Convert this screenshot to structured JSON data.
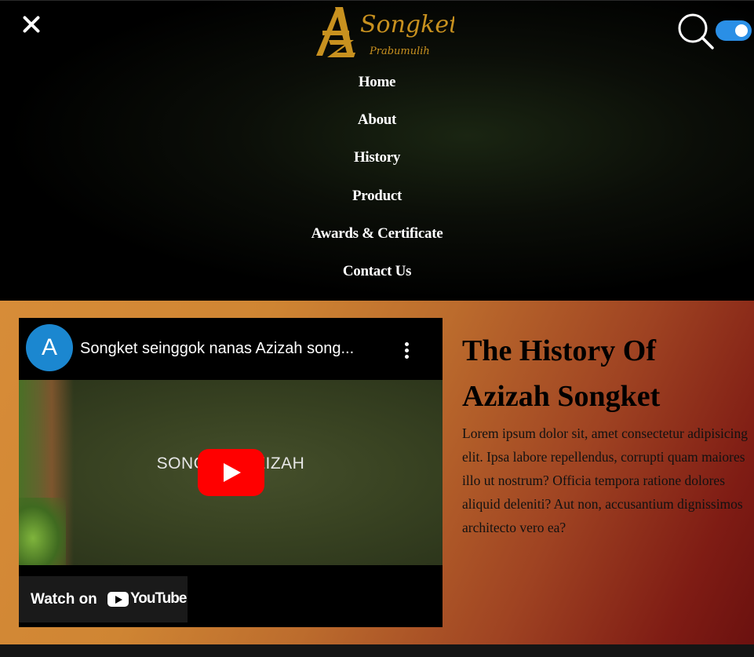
{
  "header": {
    "logo": {
      "word": "Songket",
      "sub": "Prabumulih",
      "mark": "AZ"
    },
    "close_icon": "close-icon",
    "search_icon": "search-icon",
    "theme_toggle": "on"
  },
  "nav": {
    "items": [
      "Home",
      "About",
      "History",
      "Product",
      "Awards & Certificate",
      "Contact Us"
    ]
  },
  "video": {
    "channel_initial": "A",
    "title": "Songket seinggok nanas Azizah song...",
    "frame_text": "SONGKET AZIZAH",
    "watch_on": "Watch on",
    "youtube": "YouTube"
  },
  "history": {
    "heading": "The History Of Azizah Songket",
    "body": "Lorem ipsum dolor sit, amet consectetur adipisicing elit. Ipsa labore repellendus, corrupti quam maiores illo ut nostrum? Officia tempora ratione dolores aliquid deleniti? Aut non, accusantium dignissimos architecto vero ea?"
  },
  "colors": {
    "accent": "#2a8fe6",
    "gold": "#c8911f",
    "youtube_red": "#ff0000",
    "hist_start": "#d78c38",
    "hist_end": "#6b110f"
  }
}
